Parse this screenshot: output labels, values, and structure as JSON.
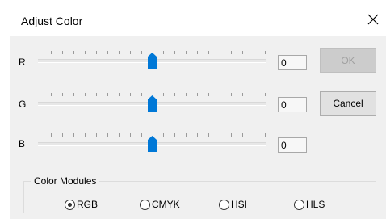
{
  "window": {
    "title": "Adjust Color",
    "close_icon": "close-icon"
  },
  "sliders": [
    {
      "label": "R",
      "value": "0",
      "position": 0.5
    },
    {
      "label": "G",
      "value": "0",
      "position": 0.5
    },
    {
      "label": "B",
      "value": "0",
      "position": 0.5
    }
  ],
  "buttons": {
    "ok_label": "OK",
    "ok_enabled": false,
    "cancel_label": "Cancel"
  },
  "color_modules": {
    "label": "Color Modules",
    "options": [
      "RGB",
      "CMYK",
      "HSI",
      "HLS"
    ],
    "selected": "RGB"
  },
  "colors": {
    "accent": "#0078d7",
    "panel": "#f0f0f0"
  }
}
